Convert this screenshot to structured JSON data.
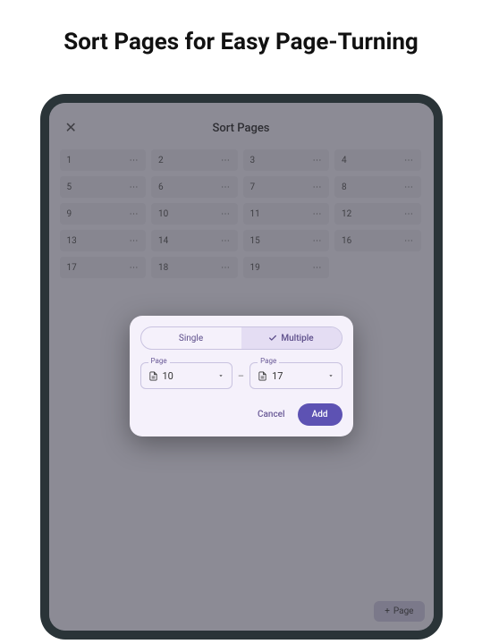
{
  "heading": "Sort Pages for Easy Page-Turning",
  "screen": {
    "title": "Sort Pages",
    "pages": [
      "1",
      "2",
      "3",
      "4",
      "5",
      "6",
      "7",
      "8",
      "9",
      "10",
      "11",
      "12",
      "13",
      "14",
      "15",
      "16",
      "17",
      "18",
      "19"
    ],
    "more_glyph": "⋯",
    "add_page_label": "Page",
    "plus_glyph": "+"
  },
  "modal": {
    "seg_single": "Single",
    "seg_multiple": "Multiple",
    "page_label": "Page",
    "from": "10",
    "to": "17",
    "cancel": "Cancel",
    "add": "Add"
  }
}
